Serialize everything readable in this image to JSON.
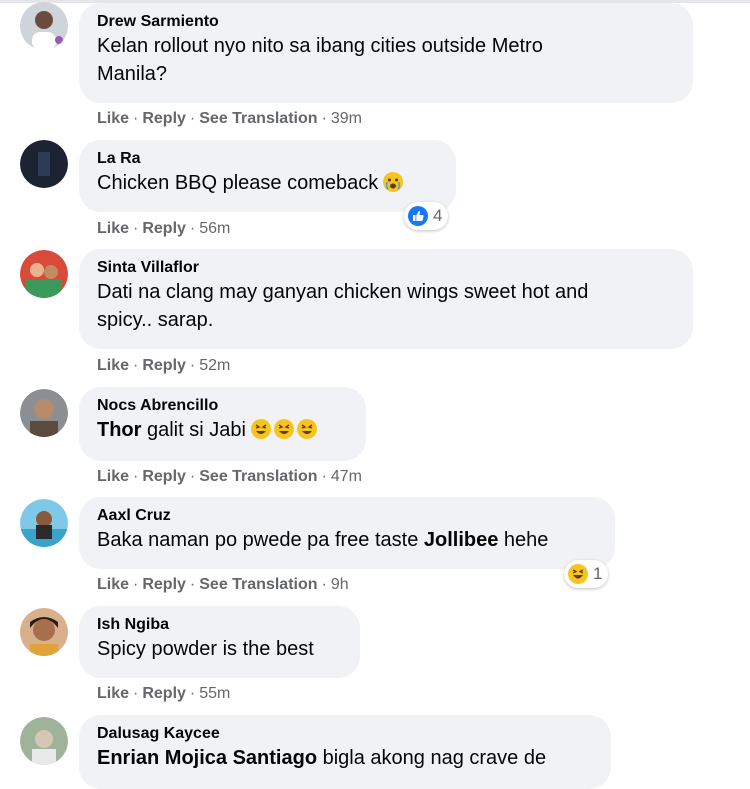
{
  "comments": [
    {
      "author": "Drew Sarmiento",
      "text1": "Kelan rollout nyo nito sa ibang cities outside Metro",
      "text2": "Manila?",
      "timestamp": "39m",
      "see_translation": "See Translation"
    },
    {
      "author": "La Ra",
      "text": "Chicken BBQ please comeback",
      "timestamp": "56m",
      "reaction_count": "4",
      "emoji": "crying-face"
    },
    {
      "author": "Sinta Villaflor",
      "text1": "Dati na clang may ganyan chicken wings sweet hot and",
      "text2": "spicy.. sarap.",
      "timestamp": "52m"
    },
    {
      "author": "Nocs Abrencillo",
      "mention": "Thor",
      "text": " galit si Jabi",
      "timestamp": "47m",
      "see_translation": "See Translation",
      "emoji": "rolling-laughing-face"
    },
    {
      "author": "Aaxl Cruz",
      "text": "Baka naman po pwede pa free taste ",
      "mention": "Jollibee",
      "text_after": " hehe",
      "timestamp": "9h",
      "see_translation": "See Translation",
      "reaction_count": "1",
      "reaction_emoji": "haha-face"
    },
    {
      "author": "Ish Ngiba",
      "text": "Spicy powder is the best",
      "timestamp": "55m"
    },
    {
      "author": "Dalusag Kaycee",
      "mention": "Enrian Mojica Santiago",
      "text": " bigla akong nag crave de"
    }
  ],
  "actions": {
    "like": "Like",
    "reply": "Reply",
    "dot": "·"
  },
  "colors": {
    "bubble": "#f0f2f5",
    "meta": "#65676b",
    "like_blue": "#1877f2",
    "emoji_yellow": "#f7c41f"
  }
}
